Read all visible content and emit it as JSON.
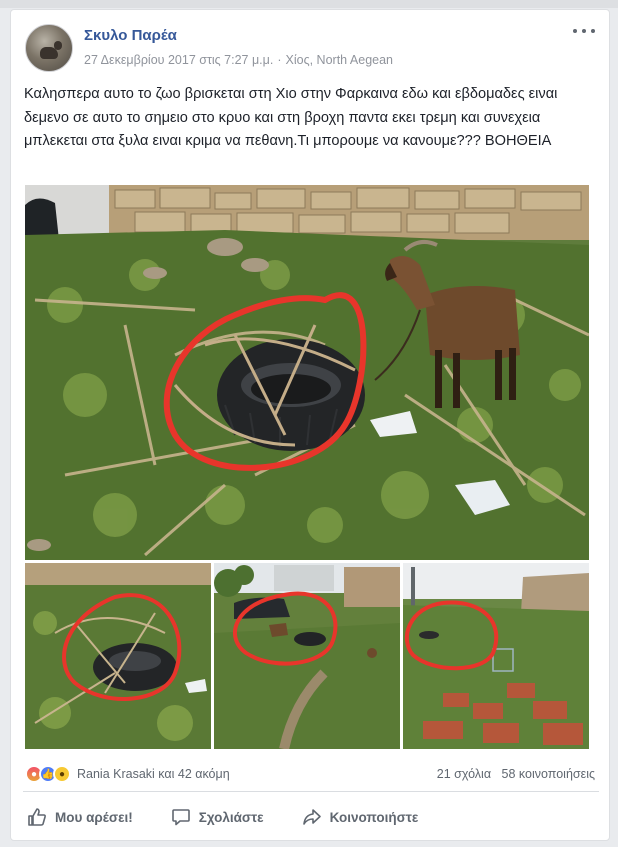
{
  "post": {
    "page_name": "Σκυλο Παρέα",
    "date": "27 Δεκεμβρίου 2017 στις 7:27 μ.μ.",
    "location": "Χίος, North Aegean",
    "text": "Καλησπερα αυτο το ζωο βρισκεται στη Χιο στην Φαρκαινα εδω και εβδομαδες ειναι δεμενο σε αυτο το σημειο στο κρυο και στη βροχη παντα εκει τρεμη και συνεχεια μπλεκεται στα ξυλα ειναι κριμα να πεθανη.Τι μπορουμε να κανουμε??? ΒΟΗΘΕΙΑ"
  },
  "reactions": {
    "icons": [
      "angry-icon",
      "like-icon",
      "sad-icon"
    ],
    "names": "Rania Krasaki και 42 ακόμη"
  },
  "stats": {
    "comments": "21 σχόλια",
    "shares": "58 κοινοποιήσεις"
  },
  "actions": {
    "like": "Μου αρέσει!",
    "comment": "Σχολιάστε",
    "share": "Κοινοποιήστε"
  },
  "colors": {
    "link": "#365899",
    "meta": "#90949c",
    "annotation_circle": "#e8352b"
  }
}
